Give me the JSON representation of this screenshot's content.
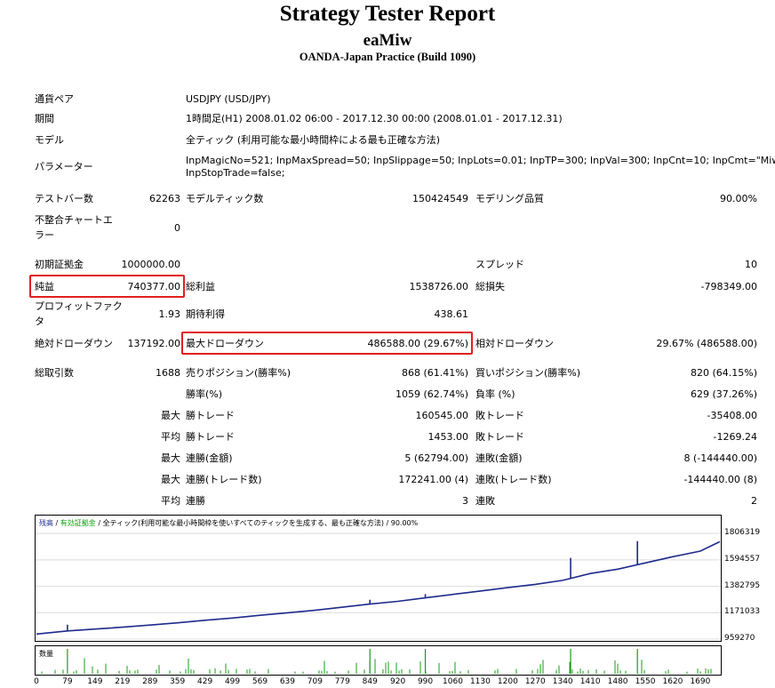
{
  "header": {
    "title": "Strategy Tester Report",
    "ea_name": "eaMiw",
    "broker": "OANDA-Japan Practice (Build 1090)"
  },
  "info": {
    "symbol_label": "通貨ペア",
    "symbol_value": "USDJPY (USD/JPY)",
    "period_label": "期間",
    "period_value": "1時間足(H1) 2008.01.02 06:00 - 2017.12.30 00:00 (2008.01.01 - 2017.12.31)",
    "model_label": "モデル",
    "model_value": "全ティック (利用可能な最小時間枠による最も正確な方法)",
    "params_label": "パラメーター",
    "params_line1": "InpMagicNo=521; InpMaxSpread=50; InpSlippage=50; InpLots=0.01; InpTP=300; InpVal=300; InpCnt=10; InpCmt=\"Miw\";",
    "params_line2": "InpStopTrade=false;"
  },
  "stats": {
    "bars_label": "テストバー数",
    "bars_value": "62263",
    "ticks_label": "モデルティック数",
    "ticks_value": "150424549",
    "quality_label": "モデリング品質",
    "quality_value": "90.00%",
    "mismatch_label1": "不整合チャートエ",
    "mismatch_label2": "ラー",
    "mismatch_value": "0",
    "deposit_label": "初期証拠金",
    "deposit_value": "1000000.00",
    "spread_label": "スプレッド",
    "spread_value": "10",
    "net_label": "純益",
    "net_value": "740377.00",
    "gross_profit_label": "総利益",
    "gross_profit_value": "1538726.00",
    "gross_loss_label": "総損失",
    "gross_loss_value": "-798349.00",
    "pf_label1": "プロフィットファク",
    "pf_label2": "タ",
    "pf_value": "1.93",
    "expected_label": "期待利得",
    "expected_value": "438.61",
    "abs_dd_label": "絶対ドローダウン",
    "abs_dd_value": "137192.00",
    "max_dd_label": "最大ドローダウン",
    "max_dd_value": "486588.00 (29.67%)",
    "rel_dd_label": "相対ドローダウン",
    "rel_dd_value": "29.67% (486588.00)",
    "trades_label": "総取引数",
    "trades_value": "1688",
    "short_label": "売りポジション(勝率%)",
    "short_value": "868 (61.41%)",
    "long_label": "買いポジション(勝率%)",
    "long_value": "820 (64.15%)",
    "winrate_label": "勝率(%)",
    "winrate_value": "1059 (62.74%)",
    "lossrate_label": "負率 (%)",
    "lossrate_value": "629 (37.26%)",
    "max_lbl": "最大",
    "avg_lbl": "平均",
    "win_trade_label": "勝トレード",
    "loss_trade_label": "敗トレード",
    "max_win_value": "160545.00",
    "max_loss_value": "-35408.00",
    "avg_win_value": "1453.00",
    "avg_loss_value": "-1269.24",
    "cons_win_money_label": "連勝(金額)",
    "cons_win_money_value": "5 (62794.00)",
    "cons_loss_money_label": "連敗(金額)",
    "cons_loss_money_value": "8 (-144440.00)",
    "cons_win_trades_label": "連勝(トレード数)",
    "cons_win_trades_value": "172241.00 (4)",
    "cons_loss_trades_label": "連敗(トレード数)",
    "cons_loss_trades_value": "-144440.00 (8)",
    "avg_cons_win_label": "連勝",
    "avg_cons_win_value": "3",
    "avg_cons_loss_label": "連敗",
    "avg_cons_loss_value": "2"
  },
  "chart_legend": {
    "balance": "残高",
    "sep1": " / ",
    "equity": "有効証拠金",
    "sep2": " / ",
    "rest": "全ティック(利用可能な最小時間枠を使いすべてのティックを生成する、最も正確な方法) / 90.00%",
    "volume": "数量"
  },
  "colors": {
    "balance": "#1e2a8c",
    "equity": "#10a010",
    "volume": "#10a010",
    "highlight": "#e0201e"
  },
  "chart_data": {
    "type": "line",
    "xlabel": "",
    "ylabel": "",
    "ylim": [
      959270,
      1850000
    ],
    "xlim": [
      0,
      1740
    ],
    "y_ticks": [
      "1806319",
      "1594557",
      "1382795",
      "1171033",
      "959270"
    ],
    "x_ticks": [
      "0",
      "79",
      "149",
      "219",
      "289",
      "359",
      "429",
      "499",
      "569",
      "639",
      "709",
      "779",
      "849",
      "920",
      "990",
      "1060",
      "1130",
      "1200",
      "1270",
      "1340",
      "1410",
      "1480",
      "1550",
      "1620",
      "1690"
    ],
    "series": [
      {
        "x": [
          0,
          79,
          149,
          219,
          289,
          359,
          429,
          499,
          569,
          639,
          709,
          779,
          849,
          920,
          990,
          1060,
          1130,
          1200,
          1270,
          1340,
          1410,
          1480,
          1550,
          1620,
          1690,
          1740
        ],
        "values": [
          1000000,
          1025000,
          1040000,
          1055000,
          1072000,
          1090000,
          1110000,
          1128000,
          1150000,
          1170000,
          1190000,
          1215000,
          1240000,
          1262000,
          1290000,
          1318000,
          1345000,
          1372000,
          1398000,
          1430000,
          1485000,
          1520000,
          1570000,
          1620000,
          1665000,
          1740000
        ]
      }
    ],
    "spikes": [
      {
        "x": 79,
        "value": 1075000
      },
      {
        "x": 849,
        "value": 1275000
      },
      {
        "x": 990,
        "value": 1320000
      },
      {
        "x": 1360,
        "value": 1610000
      },
      {
        "x": 1530,
        "value": 1745000
      }
    ]
  }
}
